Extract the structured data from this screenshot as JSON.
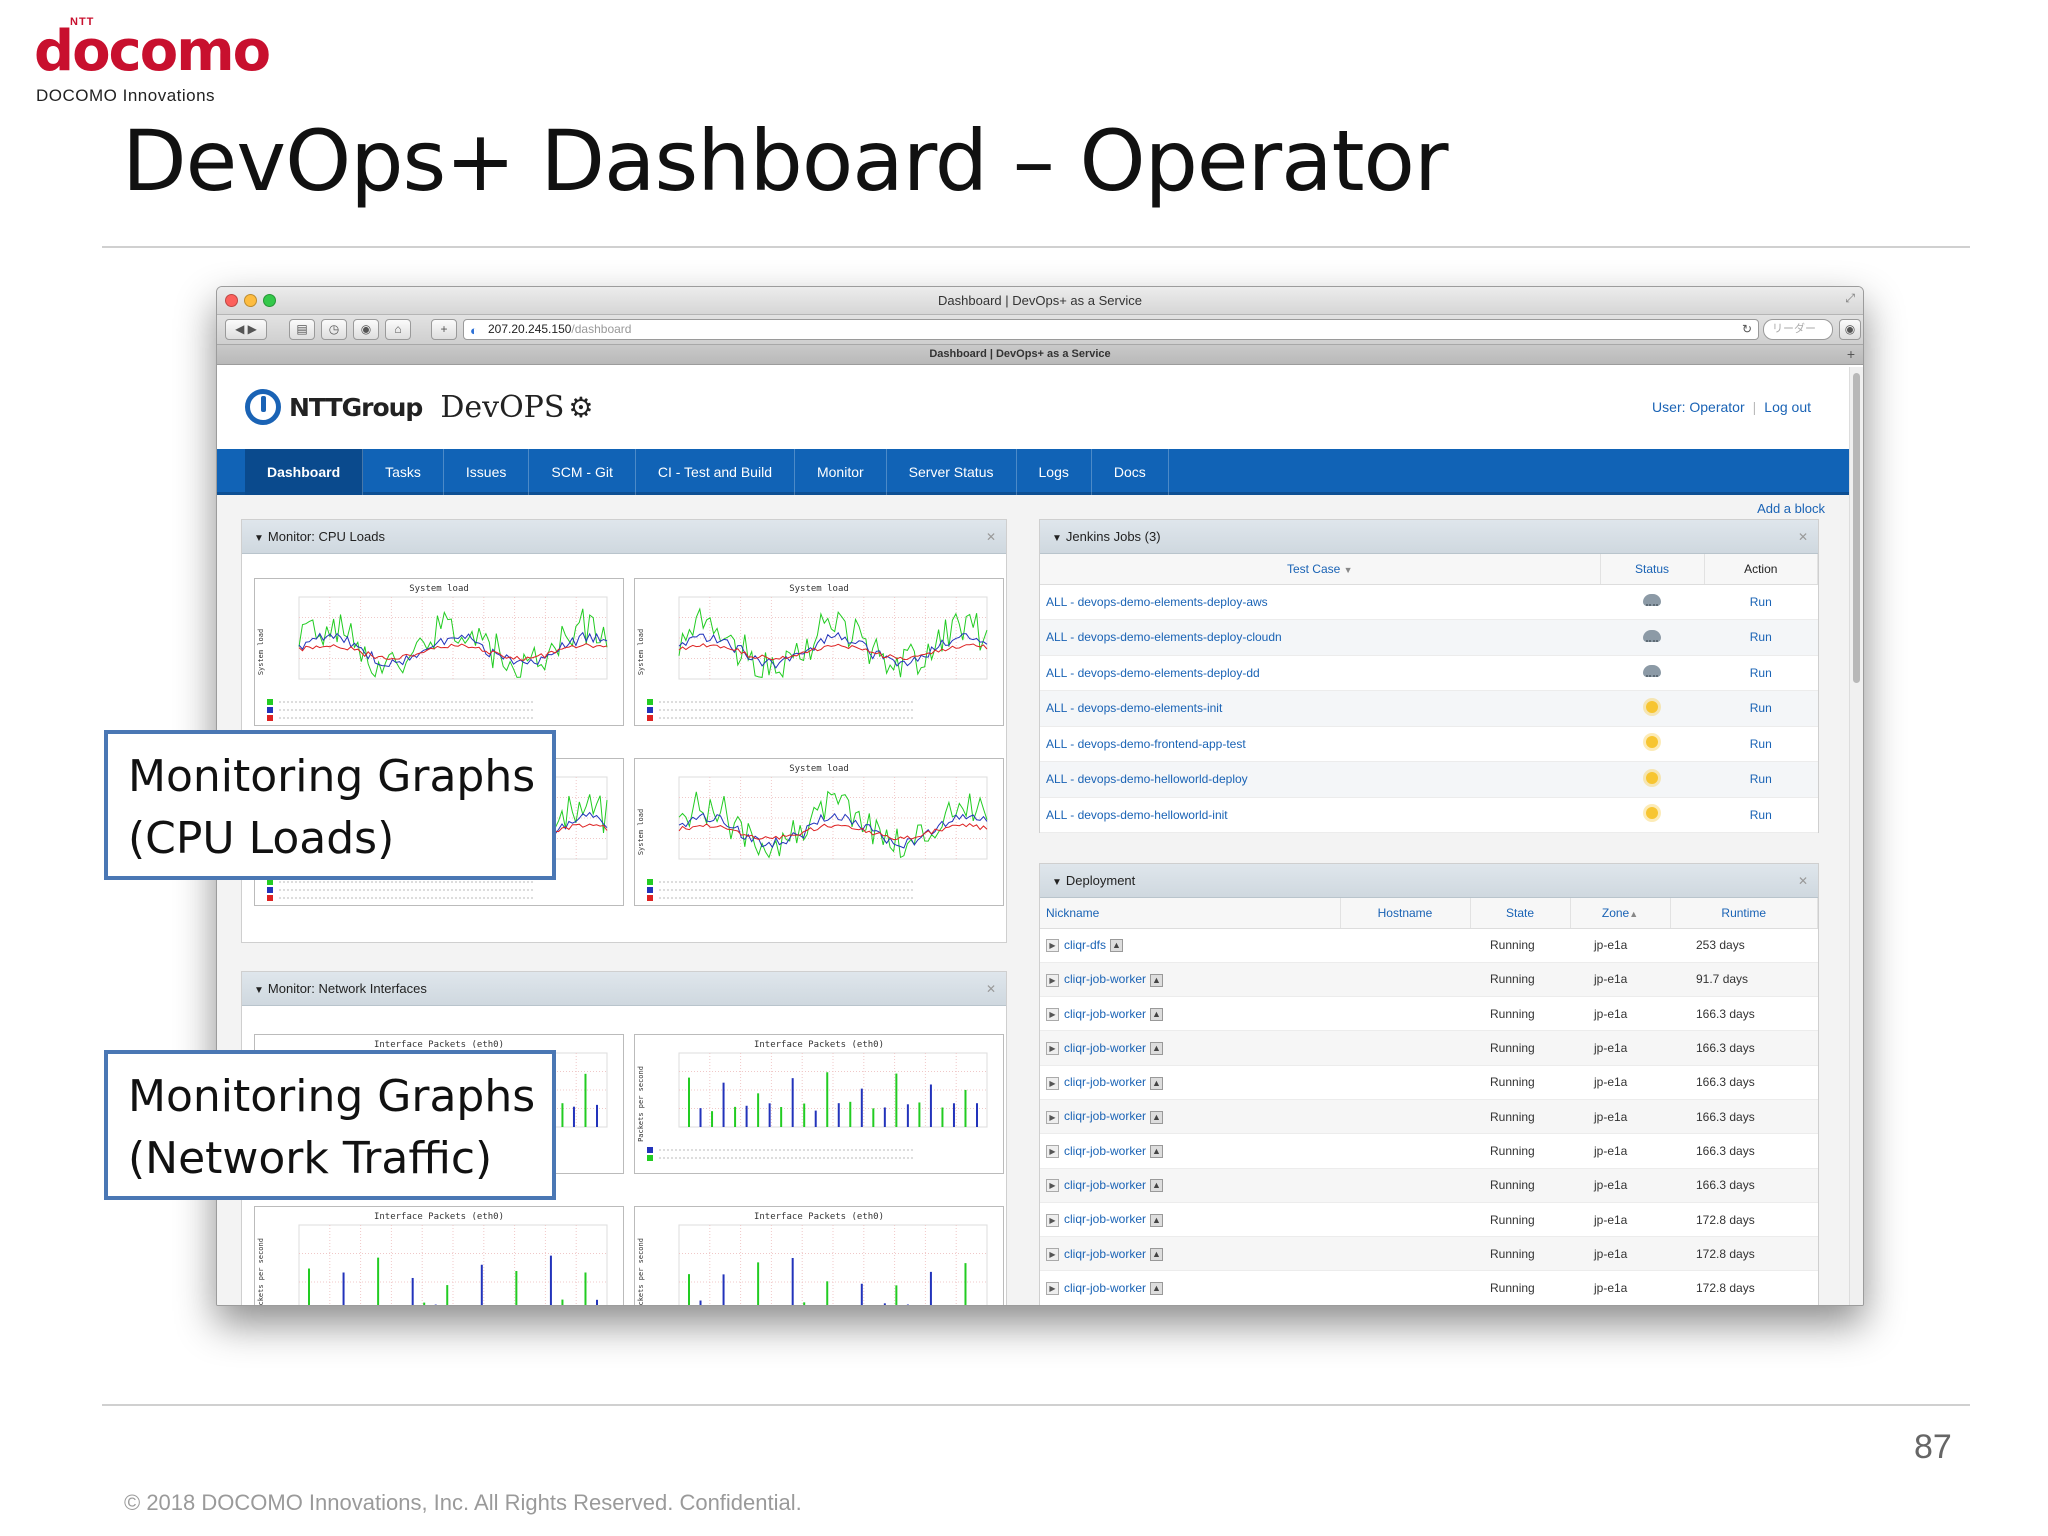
{
  "slide": {
    "logo_small": "NTT",
    "logo_word": "docomo",
    "logo_sub": "DOCOMO Innovations",
    "title": "DevOps+ Dashboard – Operator",
    "page_number": "87",
    "copyright": "© 2018 DOCOMO Innovations, Inc. All Rights Reserved. Confidential."
  },
  "callouts": [
    {
      "line1": "Monitoring Graphs",
      "line2": "(CPU Loads)"
    },
    {
      "line1": "Monitoring Graphs",
      "line2": "(Network Traffic)"
    }
  ],
  "browser": {
    "window_title": "Dashboard | DevOps+ as a Service",
    "url_host": "207.20.245.150",
    "url_path": "/dashboard",
    "search_placeholder": "リーダー",
    "tab_title": "Dashboard | DevOps+ as a Service"
  },
  "app": {
    "brand_group": "NTTGroup",
    "brand_product": "DevOPS",
    "user_label": "User: Operator",
    "logout_label": "Log out",
    "add_block": "Add a block",
    "nav": [
      "Dashboard",
      "Tasks",
      "Issues",
      "SCM - Git",
      "CI - Test and Build",
      "Monitor",
      "Server Status",
      "Logs",
      "Docs"
    ],
    "active_nav": "Dashboard"
  },
  "panels": {
    "cpu": {
      "title": "Monitor: CPU Loads",
      "graph_title": "System load",
      "ylabel": "System load"
    },
    "net": {
      "title": "Monitor: Network Interfaces",
      "graph_title": "Interface Packets (eth0)",
      "ylabel": "Packets per second"
    },
    "jenkins": {
      "title": "Jenkins Jobs (3)",
      "columns": [
        "Test Case",
        "Status",
        "Action"
      ],
      "rows": [
        {
          "name": "ALL - devops-demo-elements-deploy-aws",
          "status": "cloud",
          "action": "Run"
        },
        {
          "name": "ALL - devops-demo-elements-deploy-cloudn",
          "status": "cloud",
          "action": "Run"
        },
        {
          "name": "ALL - devops-demo-elements-deploy-dd",
          "status": "cloud",
          "action": "Run"
        },
        {
          "name": "ALL - devops-demo-elements-init",
          "status": "sun",
          "action": "Run"
        },
        {
          "name": "ALL - devops-demo-frontend-app-test",
          "status": "sun",
          "action": "Run"
        },
        {
          "name": "ALL - devops-demo-helloworld-deploy",
          "status": "sun",
          "action": "Run"
        },
        {
          "name": "ALL - devops-demo-helloworld-init",
          "status": "sun",
          "action": "Run"
        }
      ]
    },
    "deployment": {
      "title": "Deployment",
      "columns": [
        "Nickname",
        "Hostname",
        "State",
        "Zone",
        "Runtime"
      ],
      "rows": [
        {
          "nickname": "cliqr-dfs",
          "hostname": "",
          "state": "Running",
          "zone": "jp-e1a",
          "runtime": "253 days"
        },
        {
          "nickname": "cliqr-job-worker",
          "hostname": "",
          "state": "Running",
          "zone": "jp-e1a",
          "runtime": "91.7 days"
        },
        {
          "nickname": "cliqr-job-worker",
          "hostname": "",
          "state": "Running",
          "zone": "jp-e1a",
          "runtime": "166.3 days"
        },
        {
          "nickname": "cliqr-job-worker",
          "hostname": "",
          "state": "Running",
          "zone": "jp-e1a",
          "runtime": "166.3 days"
        },
        {
          "nickname": "cliqr-job-worker",
          "hostname": "",
          "state": "Running",
          "zone": "jp-e1a",
          "runtime": "166.3 days"
        },
        {
          "nickname": "cliqr-job-worker",
          "hostname": "",
          "state": "Running",
          "zone": "jp-e1a",
          "runtime": "166.3 days"
        },
        {
          "nickname": "cliqr-job-worker",
          "hostname": "",
          "state": "Running",
          "zone": "jp-e1a",
          "runtime": "166.3 days"
        },
        {
          "nickname": "cliqr-job-worker",
          "hostname": "",
          "state": "Running",
          "zone": "jp-e1a",
          "runtime": "166.3 days"
        },
        {
          "nickname": "cliqr-job-worker",
          "hostname": "",
          "state": "Running",
          "zone": "jp-e1a",
          "runtime": "172.8 days"
        },
        {
          "nickname": "cliqr-job-worker",
          "hostname": "",
          "state": "Running",
          "zone": "jp-e1a",
          "runtime": "172.8 days"
        },
        {
          "nickname": "cliqr-job-worker",
          "hostname": "",
          "state": "Running",
          "zone": "jp-e1a",
          "runtime": "172.8 days"
        }
      ]
    }
  },
  "colors": {
    "brand_red": "#c8102e",
    "nav_blue": "#1163b6",
    "callout_border": "#4a77b4",
    "line_green": "#22cc22",
    "line_blue": "#2233bb",
    "line_red": "#dd2222"
  }
}
